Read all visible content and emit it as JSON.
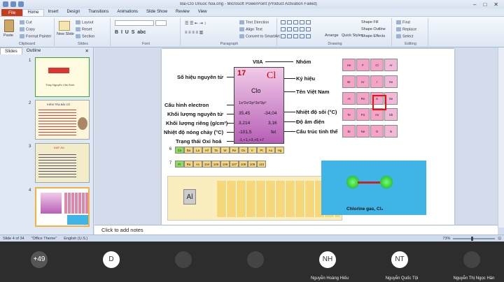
{
  "window": {
    "title": "Bai-Clo Unuoc hoa.ong - Microsoft PowerPoint (Product Activation Failed)"
  },
  "tabs": [
    "Home",
    "Insert",
    "Design",
    "Transitions",
    "Animations",
    "Slide Show",
    "Review",
    "View"
  ],
  "file_tab": "File",
  "ribbon": {
    "clipboard": {
      "label": "Clipboard",
      "paste": "Paste",
      "cut": "Cut",
      "copy": "Copy",
      "format_painter": "Format Painter"
    },
    "slides": {
      "label": "Slides",
      "new_slide": "New Slide",
      "layout": "Layout",
      "reset": "Reset",
      "section": "Section"
    },
    "font": {
      "label": "Font"
    },
    "paragraph": {
      "label": "Paragraph",
      "text_direction": "Text Direction",
      "align_text": "Align Text",
      "convert": "Convert to SmartArt"
    },
    "drawing": {
      "label": "Drawing",
      "arrange": "Arrange",
      "quick_styles": "Quick Styles",
      "shape_fill": "Shape Fill",
      "shape_outline": "Shape Outline",
      "shape_effects": "Shape Effects"
    },
    "editing": {
      "label": "Editing",
      "find": "Find",
      "replace": "Replace",
      "select": "Select"
    }
  },
  "panel": {
    "tabs": [
      "Slides",
      "Outline"
    ],
    "slide_numbers": [
      "1",
      "2",
      "3",
      "4"
    ],
    "thumb_texts": [
      "Thầy Nguyễn Văn Bình",
      "KIỂM TRA BÀI CŨ",
      "ĐÁP ÁN"
    ]
  },
  "slide": {
    "labels": {
      "group": "Nhóm",
      "vii": "VIIA",
      "atomic_no": "Số hiệu nguyên tử",
      "symbol_lbl": "Ký hiệu",
      "vn_name": "Tên Việt Nam",
      "e_config": "Cấu hình electron",
      "mass": "Khối lượng nguyên tử",
      "bp": "Nhiệt độ sôi (°C)",
      "density": "Khối lượng riêng (g/cm³)",
      "elec": "Độ âm điện",
      "mp": "Nhiệt độ nóng chảy (°C)",
      "struct": "Cấu trúc tinh thể",
      "ox": "Trạng thái Oxi hoá"
    },
    "card": {
      "number": "17",
      "symbol": "Cl",
      "name": "Clo",
      "config": "1s²2s²2p⁶3s²3p⁵",
      "mass": "35,45",
      "bp": "-34,04",
      "density": "3,214",
      "en": "3,16",
      "mp": "-101,5",
      "struct": "fet",
      "ox": "-1,+1,+3,+5,+7"
    },
    "rows": {
      "r6": {
        "num": "6",
        "cells": [
          "Cs",
          "Ba",
          "La",
          "Hf",
          "Ta",
          "W",
          "Re",
          "Os",
          "Ir",
          "Pt",
          "Au",
          "Hg"
        ]
      },
      "r7": {
        "num": "7",
        "cells": [
          "Fr",
          "Ra",
          "Ac",
          "104",
          "105",
          "106",
          "107",
          "108",
          "109",
          "110"
        ]
      }
    },
    "pt_right": {
      "cells": [
        "He",
        "F",
        "Cl",
        "Ar",
        "Br",
        "Kr",
        "I",
        "Xe",
        "At",
        "Rn",
        "S",
        "Se",
        "Te",
        "Po",
        "As",
        "Sb",
        "Bi",
        "Ne",
        "O",
        "N"
      ]
    },
    "legend_al": "Al",
    "molecule": {
      "caption": "Chlorine gas,",
      "formula": "Cl₂"
    }
  },
  "notes": "Click to add notes",
  "status": {
    "slide": "Slide 4 of 34",
    "theme": "\"Office Theme\"",
    "lang": "English (U.S.)",
    "zoom": "73%"
  },
  "video": [
    {
      "initials": "+49",
      "name": "",
      "color": "#555555"
    },
    {
      "initials": "D",
      "name": "",
      "color": "#ffffff"
    },
    {
      "initials": "",
      "name": "",
      "color": "#444444"
    },
    {
      "initials": "",
      "name": "",
      "color": "#444444"
    },
    {
      "initials": "NH",
      "name": "Nguyễn Hoàng Hiếu",
      "color": "#ffffff"
    },
    {
      "initials": "NT",
      "name": "Nguyễn Quốc Tội",
      "color": "#ffffff"
    },
    {
      "initials": "",
      "name": "Nguyễn Thị Ngọc Hân",
      "color": "#444444"
    }
  ]
}
